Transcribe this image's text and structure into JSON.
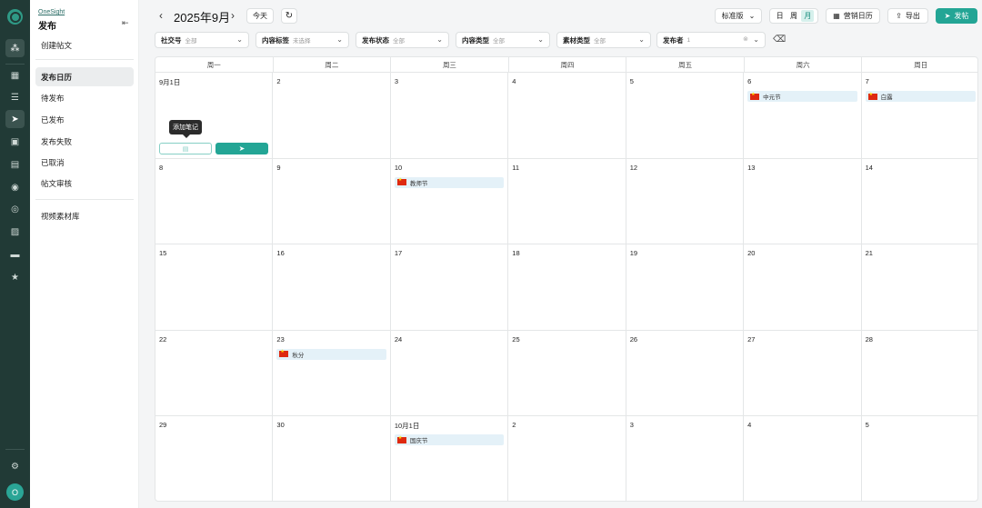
{
  "sidebar": {
    "brand": "OneSight",
    "title": "发布",
    "items": [
      {
        "label": "创建帖文"
      },
      {
        "label": "发布日历"
      },
      {
        "label": "待发布"
      },
      {
        "label": "已发布"
      },
      {
        "label": "发布失败"
      },
      {
        "label": "已取消"
      },
      {
        "label": "帖文审核"
      },
      {
        "label": "视频素材库"
      }
    ]
  },
  "rail": {
    "avatar": "O"
  },
  "toolbar": {
    "month": "2025年9月",
    "today": "今天",
    "version": "标准版",
    "views": [
      "日",
      "周",
      "月"
    ],
    "marketing_calendar": "营销日历",
    "export": "导出",
    "publish": "发帖"
  },
  "filters": [
    {
      "label": "社交号",
      "value": "全部"
    },
    {
      "label": "内容标签",
      "value": "未选择"
    },
    {
      "label": "发布状态",
      "value": "全部"
    },
    {
      "label": "内容类型",
      "value": "全部"
    },
    {
      "label": "素材类型",
      "value": "全部"
    },
    {
      "label": "发布者",
      "value": "1"
    }
  ],
  "calendar": {
    "weekdays": [
      "周一",
      "周二",
      "周三",
      "周四",
      "周五",
      "周六",
      "周日"
    ],
    "days": [
      "9月1日",
      "2",
      "3",
      "4",
      "5",
      "6",
      "7",
      "8",
      "9",
      "10",
      "11",
      "12",
      "13",
      "14",
      "15",
      "16",
      "17",
      "18",
      "19",
      "20",
      "21",
      "22",
      "23",
      "24",
      "25",
      "26",
      "27",
      "28",
      "29",
      "30",
      "10月1日",
      "2",
      "3",
      "4",
      "5"
    ],
    "events": [
      {
        "day_index": 5,
        "label": "中元节"
      },
      {
        "day_index": 6,
        "label": "白露"
      },
      {
        "day_index": 9,
        "label": "教师节"
      },
      {
        "day_index": 22,
        "label": "秋分"
      },
      {
        "day_index": 30,
        "label": "国庆节"
      }
    ]
  },
  "tooltip": "添加笔记"
}
